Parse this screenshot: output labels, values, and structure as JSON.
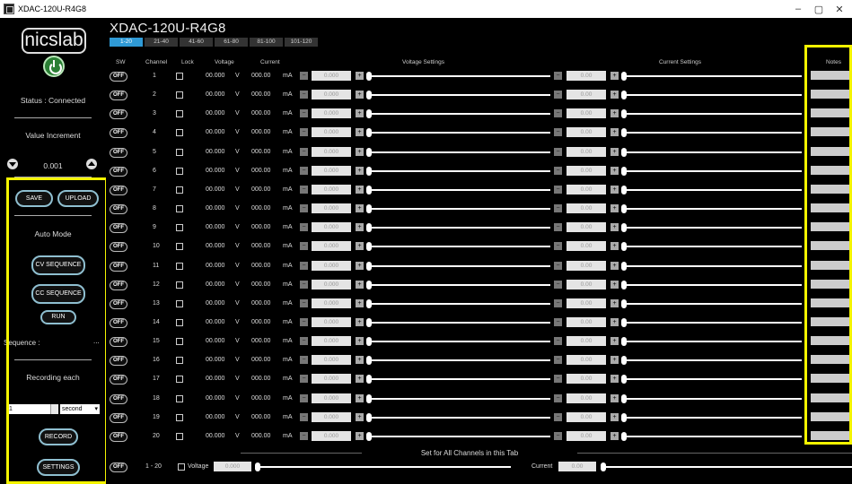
{
  "window": {
    "title": "XDAC-120U-R4G8",
    "min": "–",
    "max": "▢",
    "close": "✕"
  },
  "sidebar": {
    "logo": "nicslab",
    "status": "Status : Connected",
    "value_increment_label": "Value Increment",
    "increment_value": "0.001",
    "save_label": "SAVE",
    "upload_label": "UPLOAD",
    "auto_mode_label": "Auto Mode",
    "cv_sequence_label": "CV SEQUENCE",
    "cc_sequence_label": "CC SEQUENCE",
    "run_label": "RUN",
    "sequence_label": "Sequence :",
    "sequence_value": "...",
    "recording_label": "Recording each",
    "recording_value": "1",
    "recording_unit": "second",
    "record_label": "RECORD",
    "settings_label": "SETTINGS"
  },
  "main": {
    "device_title": "XDAC-120U-R4G8",
    "tabs": [
      "1-20",
      "21-40",
      "41-60",
      "61-80",
      "81-100",
      "101-120"
    ],
    "active_tab": "1-20",
    "headers": {
      "sw": "SW",
      "channel": "Channel",
      "lock": "Lock",
      "voltage": "Voltage",
      "current": "Current",
      "voltage_settings": "Voltage Settings",
      "current_settings": "Current Settings",
      "notes": "Notes"
    },
    "rows": [
      {
        "sw": "OFF",
        "channel": "1",
        "voltage": "00.000",
        "current": "000.00",
        "vset": "0.000",
        "cset": "0.00"
      },
      {
        "sw": "OFF",
        "channel": "2",
        "voltage": "00.000",
        "current": "000.00",
        "vset": "0.000",
        "cset": "0.00"
      },
      {
        "sw": "OFF",
        "channel": "3",
        "voltage": "00.000",
        "current": "000.00",
        "vset": "0.000",
        "cset": "0.00"
      },
      {
        "sw": "OFF",
        "channel": "4",
        "voltage": "00.000",
        "current": "000.00",
        "vset": "0.000",
        "cset": "0.00"
      },
      {
        "sw": "OFF",
        "channel": "5",
        "voltage": "00.000",
        "current": "000.00",
        "vset": "0.000",
        "cset": "0.00"
      },
      {
        "sw": "OFF",
        "channel": "6",
        "voltage": "00.000",
        "current": "000.00",
        "vset": "0.000",
        "cset": "0.00"
      },
      {
        "sw": "OFF",
        "channel": "7",
        "voltage": "00.000",
        "current": "000.00",
        "vset": "0.000",
        "cset": "0.00"
      },
      {
        "sw": "OFF",
        "channel": "8",
        "voltage": "00.000",
        "current": "000.00",
        "vset": "0.000",
        "cset": "0.00"
      },
      {
        "sw": "OFF",
        "channel": "9",
        "voltage": "00.000",
        "current": "000.00",
        "vset": "0.000",
        "cset": "0.00"
      },
      {
        "sw": "OFF",
        "channel": "10",
        "voltage": "00.000",
        "current": "000.00",
        "vset": "0.000",
        "cset": "0.00"
      },
      {
        "sw": "OFF",
        "channel": "11",
        "voltage": "00.000",
        "current": "000.00",
        "vset": "0.000",
        "cset": "0.00"
      },
      {
        "sw": "OFF",
        "channel": "12",
        "voltage": "00.000",
        "current": "000.00",
        "vset": "0.000",
        "cset": "0.00"
      },
      {
        "sw": "OFF",
        "channel": "13",
        "voltage": "00.000",
        "current": "000.00",
        "vset": "0.000",
        "cset": "0.00"
      },
      {
        "sw": "OFF",
        "channel": "14",
        "voltage": "00.000",
        "current": "000.00",
        "vset": "0.000",
        "cset": "0.00"
      },
      {
        "sw": "OFF",
        "channel": "15",
        "voltage": "00.000",
        "current": "000.00",
        "vset": "0.000",
        "cset": "0.00"
      },
      {
        "sw": "OFF",
        "channel": "16",
        "voltage": "00.000",
        "current": "000.00",
        "vset": "0.000",
        "cset": "0.00"
      },
      {
        "sw": "OFF",
        "channel": "17",
        "voltage": "00.000",
        "current": "000.00",
        "vset": "0.000",
        "cset": "0.00"
      },
      {
        "sw": "OFF",
        "channel": "18",
        "voltage": "00.000",
        "current": "000.00",
        "vset": "0.000",
        "cset": "0.00"
      },
      {
        "sw": "OFF",
        "channel": "19",
        "voltage": "00.000",
        "current": "000.00",
        "vset": "0.000",
        "cset": "0.00"
      },
      {
        "sw": "OFF",
        "channel": "20",
        "voltage": "00.000",
        "current": "000.00",
        "vset": "0.000",
        "cset": "0.00"
      }
    ],
    "units": {
      "voltage": "V",
      "current": "mA"
    },
    "buttons": {
      "minus": "−",
      "plus": "+"
    },
    "set_all": {
      "title": "Set for All Channels in this Tab",
      "sw": "OFF",
      "range": "1 - 20",
      "voltage_label": "Voltage",
      "voltage_value": "0.000",
      "current_label": "Current",
      "current_value": "0.00"
    }
  },
  "colors": {
    "accent_tab": "#2f9ad6",
    "highlight": "#f4f400",
    "power_green": "#2a7f34",
    "pill_border": "#8fbfd0"
  }
}
